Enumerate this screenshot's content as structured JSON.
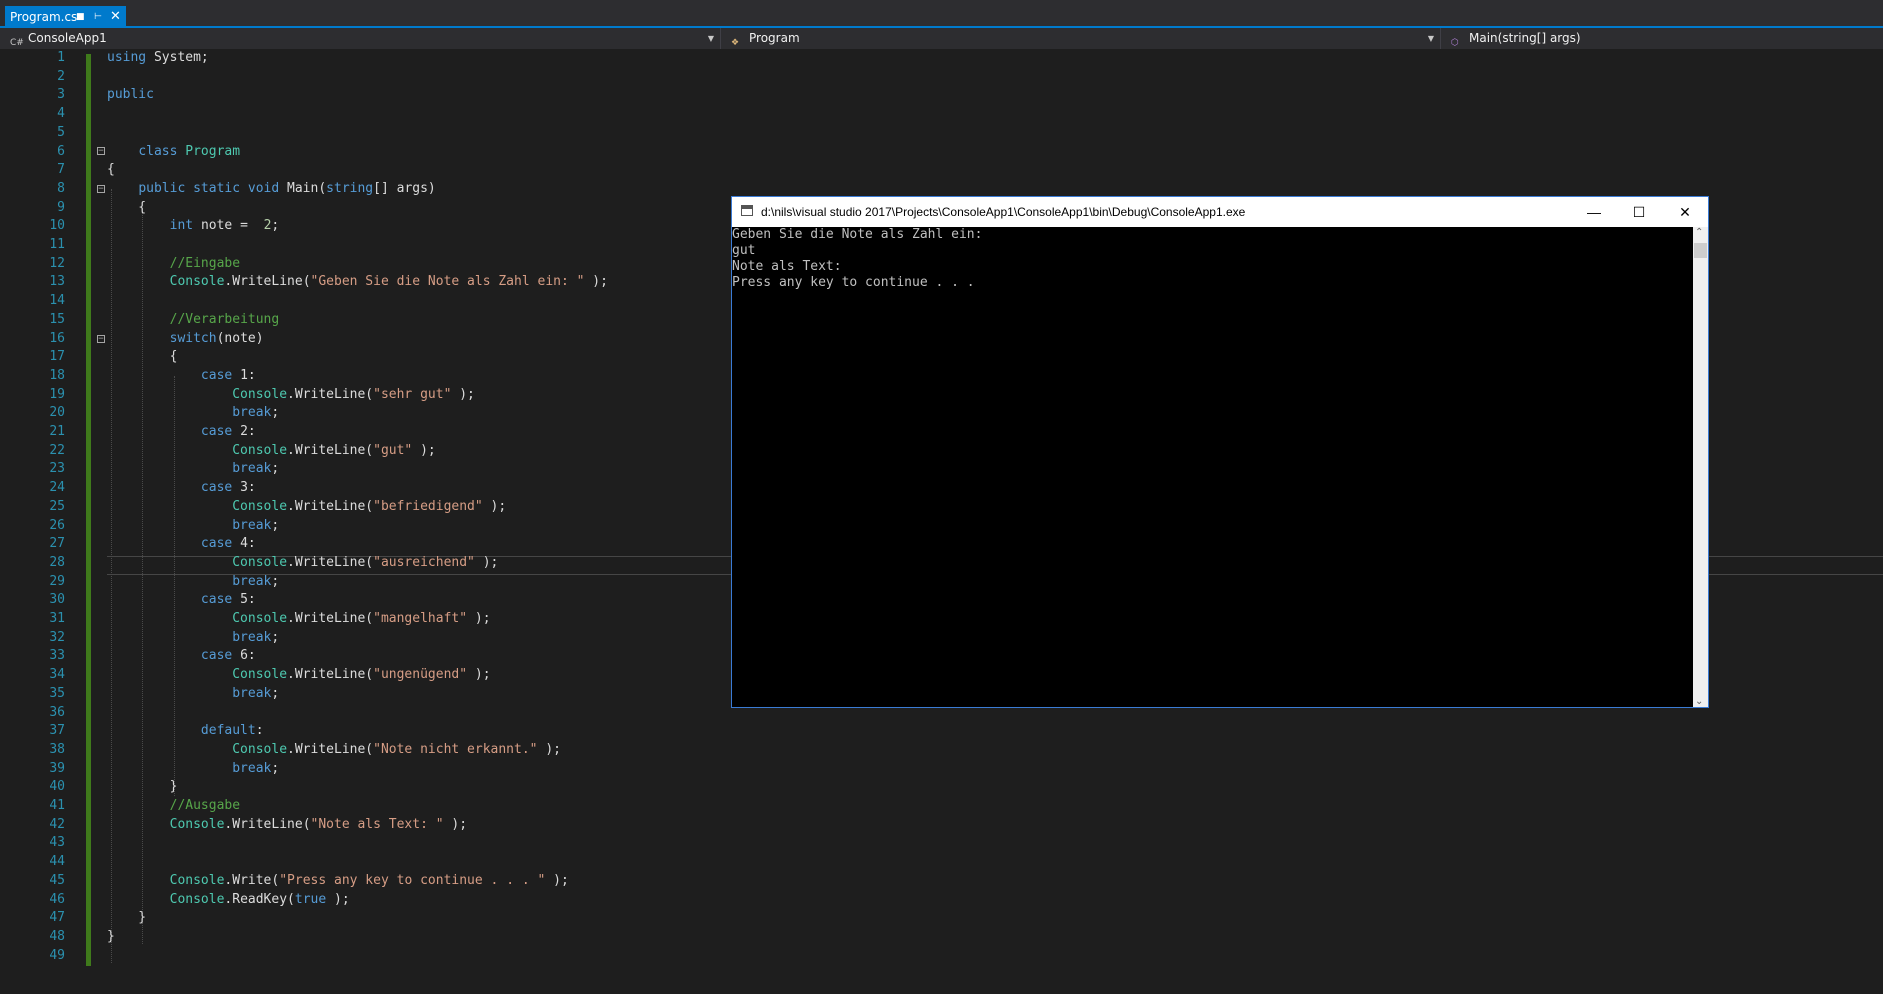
{
  "tab": {
    "label": "Program.cs"
  },
  "navbar": {
    "project": "ConsoleApp1",
    "class": "Program",
    "member": "Main(string[] args)"
  },
  "code": [
    {
      "n": "1",
      "tokens": [
        [
          "kw",
          "using"
        ],
        [
          "",
          "System;"
        ]
      ]
    },
    {
      "n": "2",
      "tokens": []
    },
    {
      "n": "3",
      "tokens": [
        [
          "kw",
          "public"
        ]
      ]
    },
    {
      "n": "4",
      "tokens": []
    },
    {
      "n": "5",
      "tokens": []
    },
    {
      "n": "6",
      "tokens": [
        [
          "",
          "    "
        ],
        [
          "kw",
          "class"
        ],
        [
          "type",
          "Program"
        ]
      ]
    },
    {
      "n": "7",
      "tokens": [
        [
          "",
          "{"
        ]
      ]
    },
    {
      "n": "8",
      "tokens": [
        [
          "",
          "    "
        ],
        [
          "kw",
          "public static void"
        ],
        [
          "",
          "Main("
        ],
        [
          "kw",
          "string"
        ],
        [
          "",
          "[] args)"
        ]
      ]
    },
    {
      "n": "9",
      "tokens": [
        [
          "",
          "    {"
        ]
      ]
    },
    {
      "n": "10",
      "tokens": [
        [
          "",
          "        "
        ],
        [
          "kw",
          "int"
        ],
        [
          "",
          "note = "
        ],
        [
          "num",
          "2"
        ],
        [
          "",
          ";"
        ]
      ]
    },
    {
      "n": "11",
      "tokens": []
    },
    {
      "n": "12",
      "tokens": [
        [
          "",
          "        "
        ],
        [
          "cmt",
          "//Eingabe"
        ]
      ]
    },
    {
      "n": "13",
      "tokens": [
        [
          "",
          "        "
        ],
        [
          "type",
          "Console"
        ],
        [
          "",
          ".WriteLine("
        ],
        [
          "str",
          "\"Geben Sie die Note als Zahl ein: \""
        ],
        [
          "",
          ");"
        ]
      ]
    },
    {
      "n": "14",
      "tokens": []
    },
    {
      "n": "15",
      "tokens": [
        [
          "",
          "        "
        ],
        [
          "cmt",
          "//Verarbeitung"
        ]
      ]
    },
    {
      "n": "16",
      "tokens": [
        [
          "",
          "        "
        ],
        [
          "kw",
          "switch"
        ],
        [
          "",
          "(note)"
        ]
      ]
    },
    {
      "n": "17",
      "tokens": [
        [
          "",
          "        {"
        ]
      ]
    },
    {
      "n": "18",
      "tokens": [
        [
          "",
          "            "
        ],
        [
          "kw",
          "case"
        ],
        [
          "",
          "1:"
        ]
      ]
    },
    {
      "n": "19",
      "tokens": [
        [
          "",
          "                "
        ],
        [
          "type",
          "Console"
        ],
        [
          "",
          ".WriteLine("
        ],
        [
          "str",
          "\"sehr gut\""
        ],
        [
          "",
          ");"
        ]
      ]
    },
    {
      "n": "20",
      "tokens": [
        [
          "",
          "                "
        ],
        [
          "kw",
          "break"
        ],
        [
          "",
          ";"
        ]
      ]
    },
    {
      "n": "21",
      "tokens": [
        [
          "",
          "            "
        ],
        [
          "kw",
          "case"
        ],
        [
          "",
          "2:"
        ]
      ]
    },
    {
      "n": "22",
      "tokens": [
        [
          "",
          "                "
        ],
        [
          "type",
          "Console"
        ],
        [
          "",
          ".WriteLine("
        ],
        [
          "str",
          "\"gut\""
        ],
        [
          "",
          ");"
        ]
      ]
    },
    {
      "n": "23",
      "tokens": [
        [
          "",
          "                "
        ],
        [
          "kw",
          "break"
        ],
        [
          "",
          ";"
        ]
      ]
    },
    {
      "n": "24",
      "tokens": [
        [
          "",
          "            "
        ],
        [
          "kw",
          "case"
        ],
        [
          "",
          "3:"
        ]
      ]
    },
    {
      "n": "25",
      "tokens": [
        [
          "",
          "                "
        ],
        [
          "type",
          "Console"
        ],
        [
          "",
          ".WriteLine("
        ],
        [
          "str",
          "\"befriedigend\""
        ],
        [
          "",
          ");"
        ]
      ]
    },
    {
      "n": "26",
      "tokens": [
        [
          "",
          "                "
        ],
        [
          "kw",
          "break"
        ],
        [
          "",
          ";"
        ]
      ]
    },
    {
      "n": "27",
      "tokens": [
        [
          "",
          "            "
        ],
        [
          "kw",
          "case"
        ],
        [
          "",
          "4:"
        ]
      ]
    },
    {
      "n": "28",
      "tokens": [
        [
          "",
          "                "
        ],
        [
          "type",
          "Console"
        ],
        [
          "",
          ".WriteLine("
        ],
        [
          "str",
          "\"ausreichend\""
        ],
        [
          "",
          ");"
        ]
      ]
    },
    {
      "n": "29",
      "tokens": [
        [
          "",
          "                "
        ],
        [
          "kw",
          "break"
        ],
        [
          "",
          ";"
        ]
      ]
    },
    {
      "n": "30",
      "tokens": [
        [
          "",
          "            "
        ],
        [
          "kw",
          "case"
        ],
        [
          "",
          "5:"
        ]
      ]
    },
    {
      "n": "31",
      "tokens": [
        [
          "",
          "                "
        ],
        [
          "type",
          "Console"
        ],
        [
          "",
          ".WriteLine("
        ],
        [
          "str",
          "\"mangelhaft\""
        ],
        [
          "",
          ");"
        ]
      ]
    },
    {
      "n": "32",
      "tokens": [
        [
          "",
          "                "
        ],
        [
          "kw",
          "break"
        ],
        [
          "",
          ";"
        ]
      ]
    },
    {
      "n": "33",
      "tokens": [
        [
          "",
          "            "
        ],
        [
          "kw",
          "case"
        ],
        [
          "",
          "6:"
        ]
      ]
    },
    {
      "n": "34",
      "tokens": [
        [
          "",
          "                "
        ],
        [
          "type",
          "Console"
        ],
        [
          "",
          ".WriteLine("
        ],
        [
          "str",
          "\"ungenügend\""
        ],
        [
          "",
          ");"
        ]
      ]
    },
    {
      "n": "35",
      "tokens": [
        [
          "",
          "                "
        ],
        [
          "kw",
          "break"
        ],
        [
          "",
          ";"
        ]
      ]
    },
    {
      "n": "36",
      "tokens": []
    },
    {
      "n": "37",
      "tokens": [
        [
          "",
          "            "
        ],
        [
          "kw",
          "default"
        ],
        [
          "",
          ":"
        ]
      ]
    },
    {
      "n": "38",
      "tokens": [
        [
          "",
          "                "
        ],
        [
          "type",
          "Console"
        ],
        [
          "",
          ".WriteLine("
        ],
        [
          "str",
          "\"Note nicht erkannt.\""
        ],
        [
          "",
          ");"
        ]
      ]
    },
    {
      "n": "39",
      "tokens": [
        [
          "",
          "                "
        ],
        [
          "kw",
          "break"
        ],
        [
          "",
          ";"
        ]
      ]
    },
    {
      "n": "40",
      "tokens": [
        [
          "",
          "        }"
        ]
      ]
    },
    {
      "n": "41",
      "tokens": [
        [
          "",
          "        "
        ],
        [
          "cmt",
          "//Ausgabe"
        ]
      ]
    },
    {
      "n": "42",
      "tokens": [
        [
          "",
          "        "
        ],
        [
          "type",
          "Console"
        ],
        [
          "",
          ".WriteLine("
        ],
        [
          "str",
          "\"Note als Text: \""
        ],
        [
          "",
          ");"
        ]
      ]
    },
    {
      "n": "43",
      "tokens": []
    },
    {
      "n": "44",
      "tokens": []
    },
    {
      "n": "45",
      "tokens": [
        [
          "",
          "        "
        ],
        [
          "type",
          "Console"
        ],
        [
          "",
          ".Write("
        ],
        [
          "str",
          "\"Press any key to continue . . . \""
        ],
        [
          "",
          ");"
        ]
      ]
    },
    {
      "n": "46",
      "tokens": [
        [
          "",
          "        "
        ],
        [
          "type",
          "Console"
        ],
        [
          "",
          ".ReadKey("
        ],
        [
          "kw",
          "true"
        ],
        [
          "",
          ");"
        ]
      ]
    },
    {
      "n": "47",
      "tokens": [
        [
          "",
          "    }"
        ]
      ]
    },
    {
      "n": "48",
      "tokens": [
        [
          "",
          "}"
        ]
      ]
    },
    {
      "n": "49",
      "tokens": []
    }
  ],
  "console": {
    "title": "d:\\nils\\visual studio 2017\\Projects\\ConsoleApp1\\ConsoleApp1\\bin\\Debug\\ConsoleApp1.exe",
    "lines": [
      "Geben Sie die Note als Zahl ein:",
      "gut",
      "Note als Text:",
      "Press any key to continue . . ."
    ]
  },
  "colors": {
    "editor_bg": "#1e1e1e",
    "accent": "#007acc",
    "keyword": "#569cd6",
    "type": "#4ec9b0",
    "string": "#d69d85",
    "comment": "#57a64a",
    "line_number": "#2b91af"
  },
  "icons": [
    "pin-icon",
    "close-icon",
    "csharp-project-icon",
    "class-icon",
    "method-icon",
    "chevron-down-icon",
    "collapse-icon",
    "console-app-icon",
    "minimize-icon",
    "maximize-icon",
    "scroll-up-icon",
    "scroll-down-icon"
  ]
}
